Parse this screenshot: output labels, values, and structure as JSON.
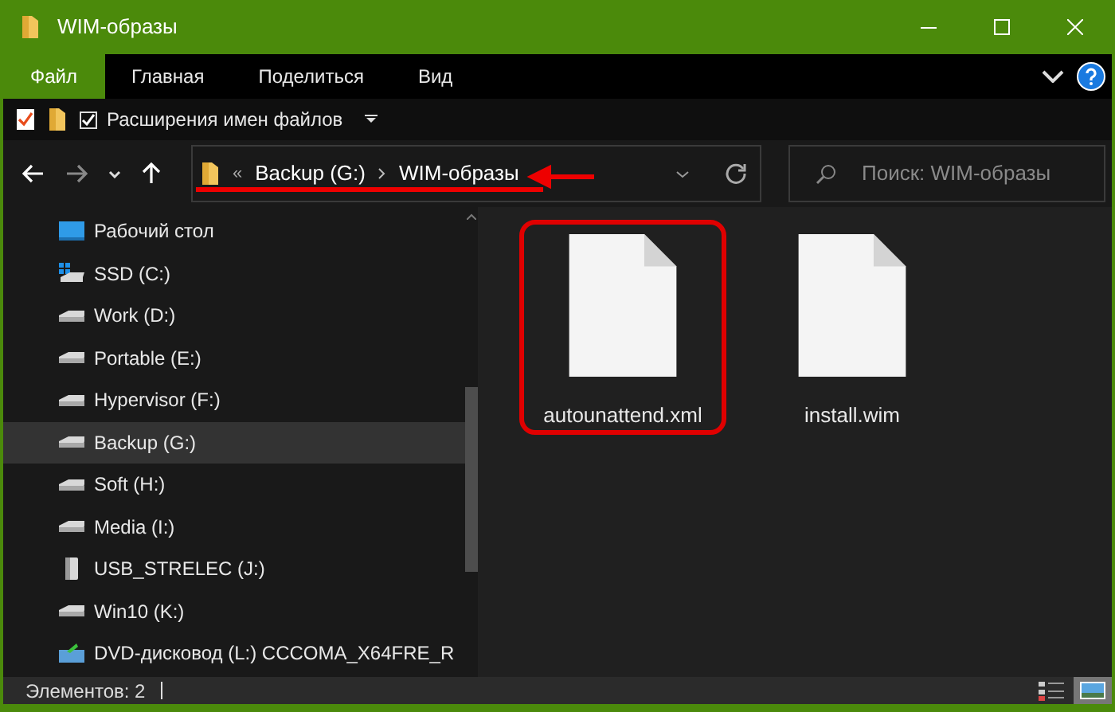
{
  "window": {
    "title": "WIM-образы"
  },
  "ribbon_tabs": [
    {
      "label": "Файл",
      "selected": true
    },
    {
      "label": "Главная",
      "selected": false
    },
    {
      "label": "Поделиться",
      "selected": false
    },
    {
      "label": "Вид",
      "selected": false
    }
  ],
  "quick_access": {
    "checkbox_label": "Расширения имен файлов",
    "checked": true
  },
  "address_bar": {
    "overflow": "«",
    "path": [
      "Backup (G:)",
      "WIM-образы"
    ],
    "annotated": true
  },
  "search": {
    "placeholder": "Поиск: WIM-образы"
  },
  "sidebar": {
    "items": [
      {
        "label": "Рабочий стол",
        "kind": "desktop",
        "selected": false
      },
      {
        "label": "SSD (C:)",
        "kind": "system",
        "selected": false
      },
      {
        "label": "Work (D:)",
        "kind": "drive",
        "selected": false
      },
      {
        "label": "Portable (E:)",
        "kind": "drive",
        "selected": false
      },
      {
        "label": "Hypervisor (F:)",
        "kind": "drive",
        "selected": false
      },
      {
        "label": "Backup (G:)",
        "kind": "drive",
        "selected": true
      },
      {
        "label": "Soft (H:)",
        "kind": "drive",
        "selected": false
      },
      {
        "label": "Media (I:)",
        "kind": "drive",
        "selected": false
      },
      {
        "label": "USB_STRELEC (J:)",
        "kind": "usb",
        "selected": false
      },
      {
        "label": "Win10 (K:)",
        "kind": "drive",
        "selected": false
      },
      {
        "label": "DVD-дисковод (L:) CCCOMA_X64FRE_R",
        "kind": "dvd",
        "selected": false
      }
    ]
  },
  "files": [
    {
      "name": "autounattend.xml",
      "annotated": true
    },
    {
      "name": "install.wim",
      "annotated": false
    }
  ],
  "status_bar": {
    "count": "Элементов: 2"
  }
}
